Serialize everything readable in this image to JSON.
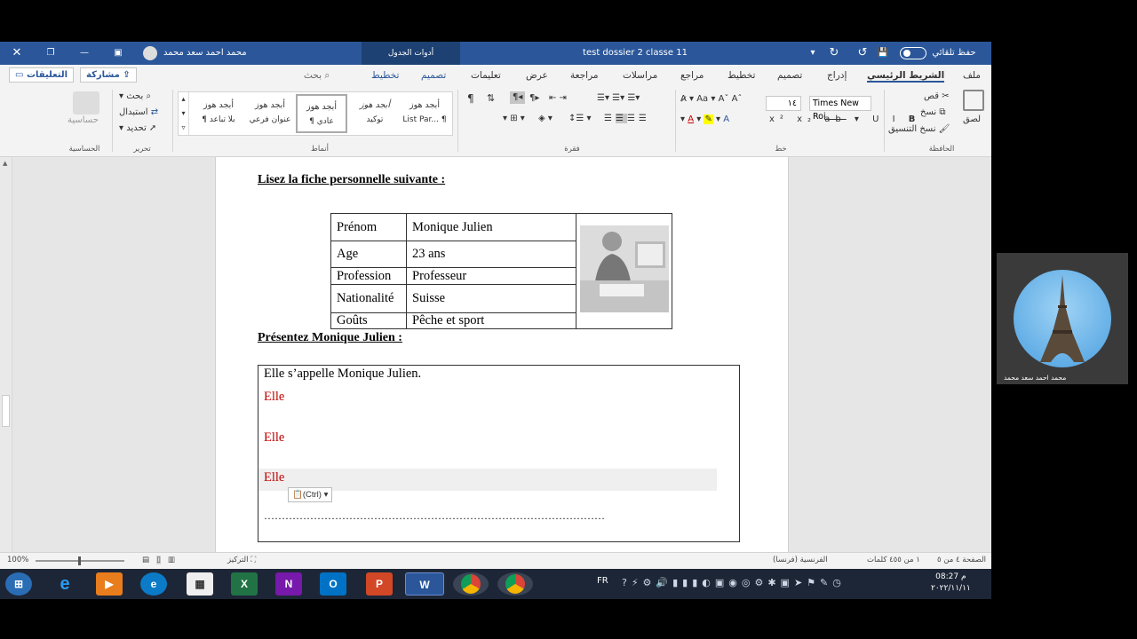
{
  "titlebar": {
    "doc_title": "test dossier 2 classe 11",
    "autosave": "حفظ تلقائي",
    "context_tab": "أدوات الجدول",
    "user": "محمد احمد سعد محمد"
  },
  "tabs": {
    "file": "ملف",
    "home": "الشريط الرئيسي",
    "insert": "إدراج",
    "design": "تصميم",
    "layout": "تخطيط",
    "references": "مراجع",
    "mailings": "مراسلات",
    "review": "مراجعة",
    "view": "عرض",
    "help": "تعليمات",
    "table_design": "تصميم",
    "table_layout": "تخطيط",
    "search": "بحث",
    "share": "مشاركة",
    "comments": "التعليقات"
  },
  "ribbon": {
    "clipboard": {
      "paste": "لصق",
      "cut": "قص",
      "copy": "نسخ",
      "format_painter": "نسخ التنسيق",
      "label": "الحافظة"
    },
    "font": {
      "name": "Times New Roi",
      "size": "١٤",
      "label": "خط"
    },
    "paragraph": {
      "label": "فقرة"
    },
    "styles": {
      "label": "أنماط",
      "items": [
        {
          "sample": "أبجد هوز",
          "name": "List Par... ¶"
        },
        {
          "sample": "أبجد هوز",
          "name": "توكيد"
        },
        {
          "sample": "أبجد هوز",
          "name": "¶ عادي"
        },
        {
          "sample": "أبجد هوز",
          "name": "عنوان فرعي"
        },
        {
          "sample": "أبجد هوز",
          "name": "¶ بلا تباعد"
        }
      ]
    },
    "editing": {
      "find": "بحث",
      "replace": "استبدال",
      "select": "تحديد",
      "label": "تحرير"
    },
    "sensitivity": {
      "btn": "حساسية",
      "label": "الحساسية"
    }
  },
  "document": {
    "heading1": "Lisez la fiche personnelle suivante :",
    "table": [
      {
        "label": "Prénom",
        "value": "Monique Julien"
      },
      {
        "label": "Age",
        "value": "23 ans"
      },
      {
        "label": "Profession",
        "value": "Professeur"
      },
      {
        "label": "Nationalité",
        "value": "Suisse"
      },
      {
        "label": "Goûts",
        "value": "Pêche et sport"
      }
    ],
    "heading2": "Présentez Monique Julien :",
    "answer_line1": "Elle s’appelle Monique Julien.",
    "answer_line2": "Elle",
    "answer_line3": "Elle",
    "answer_line4": "Elle",
    "paste_options": "(Ctrl)",
    "dots": "……………………………………………………………………………………"
  },
  "statusbar": {
    "page": "الصفحة ٤ من ٥",
    "words": "١ من ٤٥٥ كلمات",
    "language": "الفرنسية (فرنسا)",
    "focus": "التركيز",
    "zoom": "100%"
  },
  "taskbar": {
    "lang": "FR",
    "time": "08:27 م",
    "date": "٢٠٢٢/١١/١١"
  },
  "webcam": {
    "name": "محمد احمد سعد محمد"
  }
}
